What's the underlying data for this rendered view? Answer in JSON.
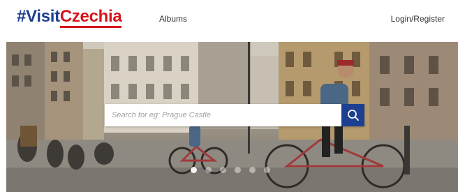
{
  "header": {
    "logo_prefix": "#Visit",
    "logo_suffix": "Czechia",
    "nav_albums": "Albums",
    "nav_login": "Login/Register"
  },
  "hero": {
    "image_description_icon": "city-street-photo",
    "search": {
      "placeholder": "Search for eg: Prague Castle",
      "value": ""
    },
    "search_icon": "search-icon",
    "carousel": {
      "slide_count": 6,
      "active_index": 0
    }
  },
  "colors": {
    "brand_blue": "#1d3f8f",
    "brand_red": "#d7141a"
  }
}
